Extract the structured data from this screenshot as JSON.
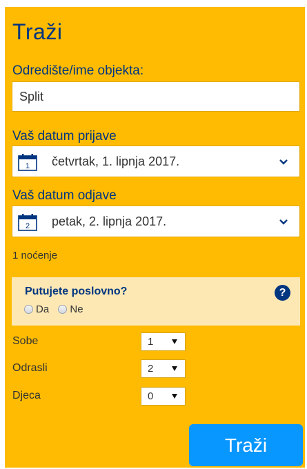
{
  "form": {
    "title": "Traži",
    "destination": {
      "label": "Odredište/ime objekta:",
      "value": "Split"
    },
    "checkin": {
      "label": "Vaš datum prijave",
      "day": "1",
      "value": "četvrtak, 1. lipnja 2017."
    },
    "checkout": {
      "label": "Vaš datum odjave",
      "day": "2",
      "value": "petak, 2. lipnja 2017."
    },
    "nights": "1 noćenje",
    "business": {
      "question": "Putujete poslovno?",
      "help": "?",
      "yes": "Da",
      "no": "Ne"
    },
    "rooms": {
      "label": "Sobe",
      "value": "1"
    },
    "adults": {
      "label": "Odrasli",
      "value": "2"
    },
    "children": {
      "label": "Djeca",
      "value": "0"
    },
    "submit": "Traži"
  },
  "colors": {
    "panel": "#febb02",
    "primary_text": "#003580",
    "button": "#0896ff",
    "business_box": "#fde8b4"
  },
  "icons": [
    "calendar-icon",
    "chevron-down-icon",
    "help-icon",
    "dropdown-arrow-icon"
  ]
}
